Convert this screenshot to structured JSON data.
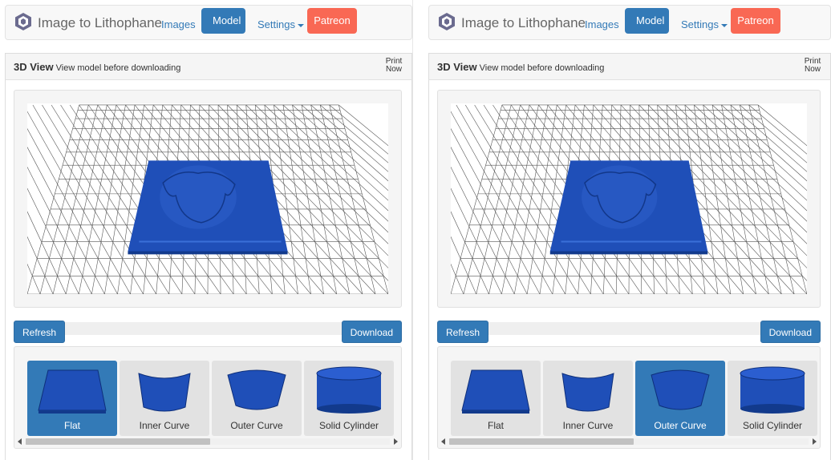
{
  "colors": {
    "primary": "#337ab7",
    "patreon": "#f96854",
    "model_blue": "#1f4fb8"
  },
  "brand": {
    "icon": "lithophane-hexagon-icon",
    "text": "Image to Lithophane"
  },
  "nav": {
    "images": "Images",
    "model": "Model",
    "settings": "Settings",
    "patreon": "Patreon"
  },
  "panel": {
    "title": "3D View",
    "subtitle": "View model before downloading",
    "print_line1": "Print",
    "print_line2": "Now"
  },
  "controls": {
    "refresh": "Refresh",
    "download": "Download"
  },
  "shapes": [
    {
      "label": "Flat",
      "icon": "flat-plate-thumb-icon"
    },
    {
      "label": "Inner Curve",
      "icon": "inner-curve-thumb-icon"
    },
    {
      "label": "Outer Curve",
      "icon": "outer-curve-thumb-icon"
    },
    {
      "label": "Solid Cylinder",
      "icon": "solid-cylinder-thumb-icon"
    }
  ],
  "left_view": {
    "selected_shape": "Flat"
  },
  "right_view": {
    "selected_shape": "Outer Curve"
  }
}
